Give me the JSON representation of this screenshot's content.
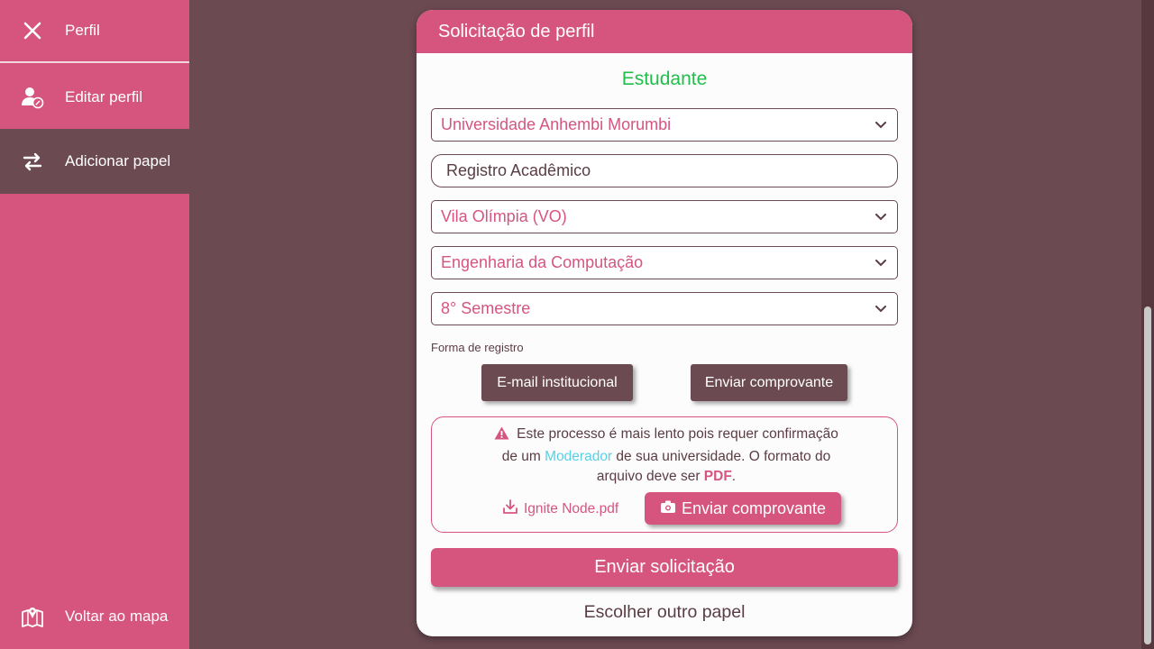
{
  "sidebar": {
    "items": [
      {
        "label": "Perfil",
        "icon": "close-icon"
      },
      {
        "label": "Editar perfil",
        "icon": "user-edit-icon"
      },
      {
        "label": "Adicionar papel",
        "icon": "swap-arrows-icon"
      },
      {
        "label": "Voltar ao mapa",
        "icon": "map-icon"
      }
    ]
  },
  "card": {
    "title": "Solicitação de perfil",
    "role": "Estudante",
    "university": "Universidade Anhembi Morumbi",
    "registro_placeholder": "Registro Acadêmico",
    "campus": "Vila Olímpia (VO)",
    "course": "Engenharia da Computação",
    "semester": "8° Semestre",
    "registration_form_label": "Forma de registro",
    "email_button": "E-mail institucional",
    "proof_button": "Enviar comprovante",
    "info": {
      "part1": "Este processo é mais lento pois requer confirmação de um ",
      "moderator": "Moderador",
      "part2": " de sua universidade. O formato do arquivo deve ser ",
      "format": "PDF",
      "part3": "."
    },
    "file_name": "Ignite Node.pdf",
    "upload_button": "Enviar comprovante",
    "submit_button": "Enviar solicitação",
    "other_role": "Escolher outro papel"
  },
  "colors": {
    "primary": "#d6557f",
    "dark": "#6b4a52",
    "success": "#1fbf4a",
    "link": "#5ad0e6"
  }
}
